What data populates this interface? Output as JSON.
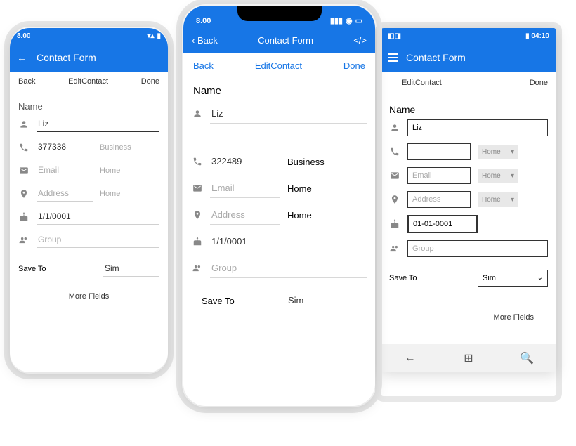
{
  "common": {
    "app_title": "Contact Form",
    "back_btn": "Back",
    "edit_btn": "EditContact",
    "done_btn": "Done",
    "section_name": "Name",
    "more_fields": "More Fields",
    "save_to": "Save To",
    "sim": "Sim"
  },
  "android": {
    "time": "8.00",
    "name_value": "Liz",
    "phone_value": "377338",
    "phone_type": "Business",
    "email_placeholder": "Email",
    "email_type": "Home",
    "address_placeholder": "Address",
    "address_type": "Home",
    "date_value": "1/1/0001",
    "group_placeholder": "Group"
  },
  "ios": {
    "time": "8.00",
    "nav_back": "Back",
    "code_icon": "</>",
    "name_value": "Liz",
    "phone_value": "322489",
    "phone_type": "Business",
    "email_placeholder": "Email",
    "email_type": "Home",
    "address_placeholder": "Address",
    "address_type": "Home",
    "date_value": "1/1/0001",
    "group_placeholder": "Group"
  },
  "win": {
    "time": "04:10",
    "name_value": "Liz",
    "phone_type": "Home",
    "email_placeholder": "Email",
    "email_type": "Home",
    "address_placeholder": "Address",
    "address_type": "Home",
    "date_value": "01-01-0001",
    "group_placeholder": "Group"
  }
}
